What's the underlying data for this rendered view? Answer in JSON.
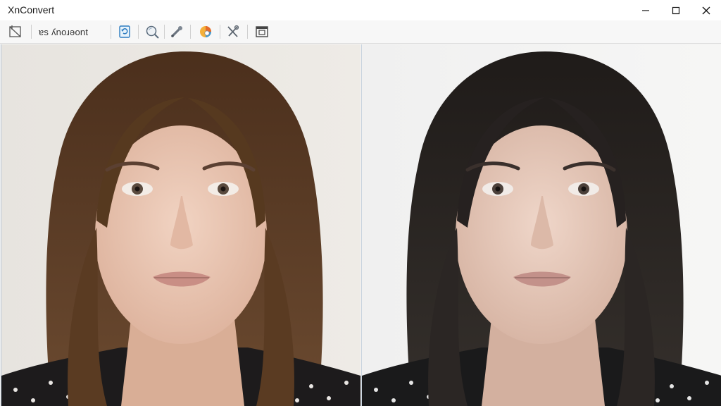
{
  "window": {
    "title": "XnConvert"
  },
  "window_controls": {
    "minimize": "minimize-icon",
    "maximize": "maximize-icon",
    "close": "close-icon"
  },
  "toolbar": {
    "label": "ɐs ʎnoɹǝont"
  },
  "icons": {
    "tool_1": "crop-icon",
    "tool_2": "refresh-icon",
    "tool_3": "zoom-icon",
    "tool_4": "pipette-icon",
    "tool_5": "color-wheel-icon",
    "tool_6": "tools-icon",
    "tool_7": "frame-icon"
  },
  "panels": {
    "left": {
      "image": "portrait-original",
      "hair": "#5b3d26"
    },
    "right": {
      "image": "portrait-converted",
      "hair": "#2a2422"
    }
  }
}
